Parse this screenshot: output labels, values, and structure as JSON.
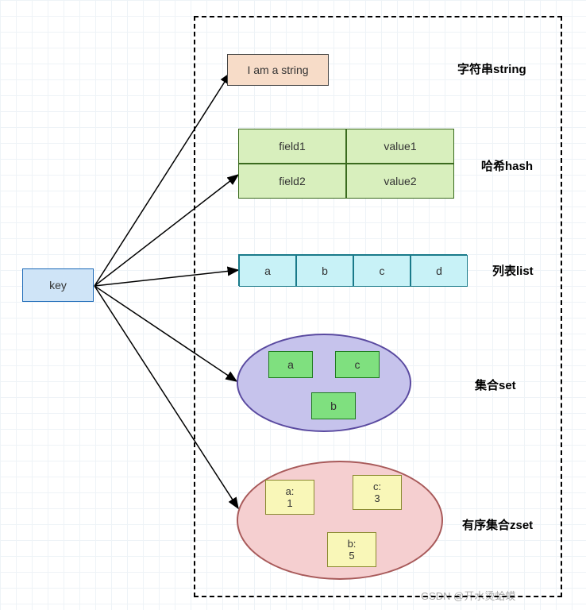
{
  "key": {
    "label": "key"
  },
  "types": {
    "string": {
      "title": "字符串string",
      "value": "I am a string"
    },
    "hash": {
      "title": "哈希hash",
      "rows": [
        {
          "field": "field1",
          "value": "value1"
        },
        {
          "field": "field2",
          "value": "value2"
        }
      ]
    },
    "list": {
      "title": "列表list",
      "items": [
        "a",
        "b",
        "c",
        "d"
      ]
    },
    "set": {
      "title": "集合set",
      "items": [
        "a",
        "c",
        "b"
      ]
    },
    "zset": {
      "title": "有序集合zset",
      "items": [
        {
          "member": "a",
          "score": 1
        },
        {
          "member": "c",
          "score": 3
        },
        {
          "member": "b",
          "score": 5
        }
      ]
    }
  },
  "watermark": "GSDN @开水烫蛤蟆"
}
